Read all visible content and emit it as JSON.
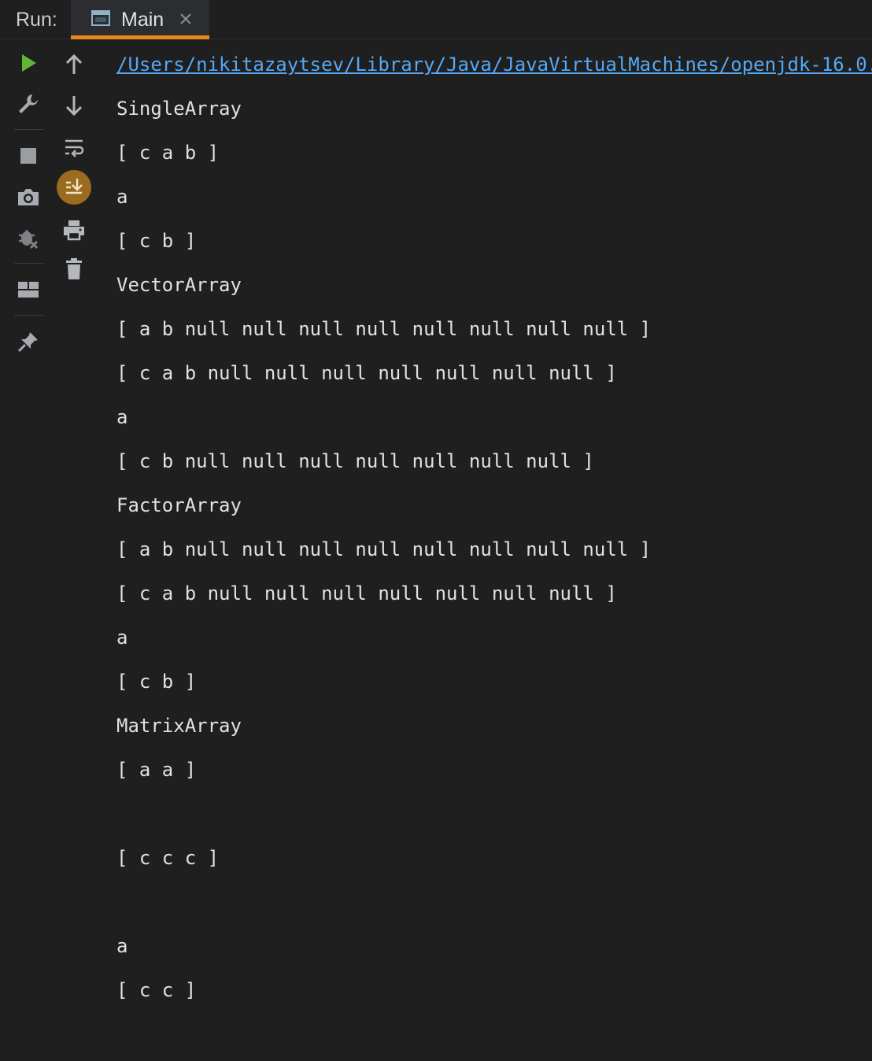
{
  "header": {
    "run_label": "Run:",
    "tab_label": "Main"
  },
  "toolbar_left": [
    {
      "icon": "play-icon",
      "color": "#5fb832"
    },
    {
      "icon": "wrench-icon"
    },
    {
      "icon": "stop-icon"
    },
    {
      "icon": "camera-icon"
    },
    {
      "icon": "debug-icon"
    },
    {
      "icon": "layout-icon"
    },
    {
      "icon": "pin-icon"
    }
  ],
  "toolbar_right": [
    {
      "icon": "arrow-up-icon"
    },
    {
      "icon": "arrow-down-icon"
    },
    {
      "icon": "soft-wrap-icon"
    },
    {
      "icon": "scroll-to-end-icon",
      "active": true,
      "color": "#9b6b1f"
    },
    {
      "icon": "print-icon"
    },
    {
      "icon": "trash-icon"
    }
  ],
  "console": {
    "lines": [
      "/Users/nikitazaytsev/Library/Java/JavaVirtualMachines/openjdk-16.0.",
      "SingleArray",
      "[ c a b ]",
      "a",
      "[ c b ]",
      "VectorArray",
      "[ a b null null null null null null null null ]",
      "[ c a b null null null null null null null ]",
      "a",
      "[ c b null null null null null null null ]",
      "FactorArray",
      "[ a b null null null null null null null null ]",
      "[ c a b null null null null null null null ]",
      "a",
      "[ c b ]",
      "MatrixArray",
      "[ a a ]",
      "",
      "[ c c c ]",
      "",
      "a",
      "[ c c ]"
    ]
  }
}
